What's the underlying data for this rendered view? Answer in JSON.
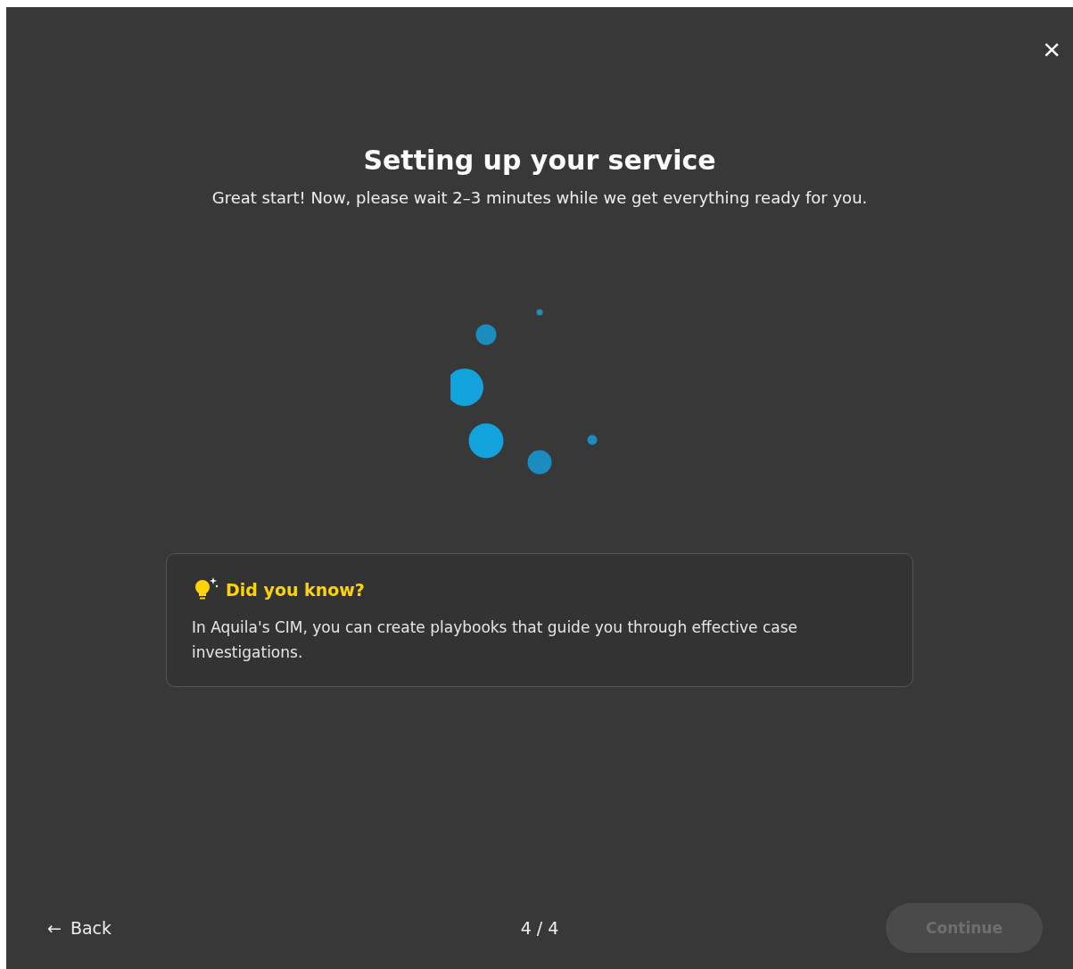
{
  "dialog": {
    "close": "×",
    "title": "Setting up your service",
    "subtitle": "Great start! Now, please wait 2–3 minutes while we get everything ready for you."
  },
  "tip": {
    "title": "Did you know?",
    "text": "In Aquila's CIM, you can create playbooks that guide you through effective case investigations."
  },
  "footer": {
    "back": "Back",
    "back_arrow": "←",
    "progress": "4 / 4",
    "continue": {
      "label": "Continue",
      "disabled": true
    }
  }
}
